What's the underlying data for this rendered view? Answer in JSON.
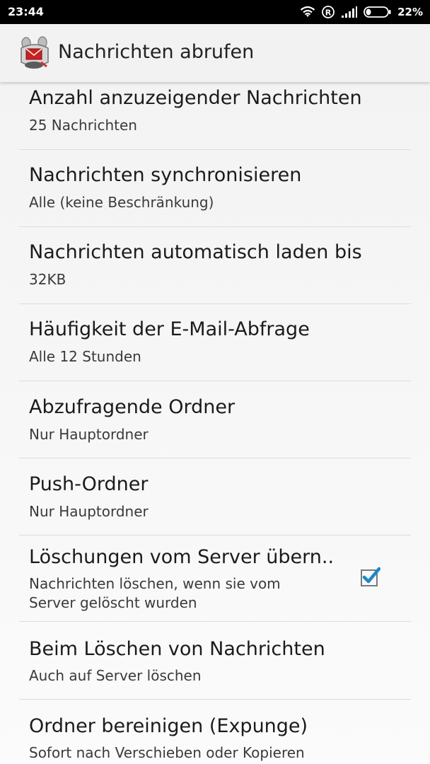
{
  "status_bar": {
    "time": "23:44",
    "battery_percent": "22%",
    "icons": [
      "wifi-icon",
      "roaming-icon",
      "signal-icon",
      "battery-icon"
    ]
  },
  "app_bar": {
    "title": "Nachrichten abrufen",
    "logo_icon": "k9-mail-logo-icon"
  },
  "settings": [
    {
      "title": "Anzahl anzuzeigender Nachrichten",
      "summary": "25 Nachrichten"
    },
    {
      "title": "Nachrichten synchronisieren",
      "summary": "Alle (keine Beschränkung)"
    },
    {
      "title": "Nachrichten automatisch laden bis",
      "summary": "32KB"
    },
    {
      "title": "Häufigkeit der E-Mail-Abfrage",
      "summary": "Alle 12 Stunden"
    },
    {
      "title": "Abzufragende Ordner",
      "summary": "Nur Hauptordner"
    },
    {
      "title": "Push-Ordner",
      "summary": "Nur Hauptordner"
    },
    {
      "title": "Löschungen vom Server übern..",
      "summary_line1": "Nachrichten löschen, wenn sie vom",
      "summary_line2": "Server gelöscht wurden",
      "checked": true
    },
    {
      "title": "Beim Löschen von Nachrichten",
      "summary": "Auch auf Server löschen"
    },
    {
      "title": "Ordner bereinigen (Expunge)",
      "summary": "Sofort nach Verschieben oder Kopieren"
    }
  ],
  "colors": {
    "checkbox_check": "#1e88c8",
    "status_bar_bg": "#000000",
    "app_bar_bg": "#f2f2f2"
  }
}
